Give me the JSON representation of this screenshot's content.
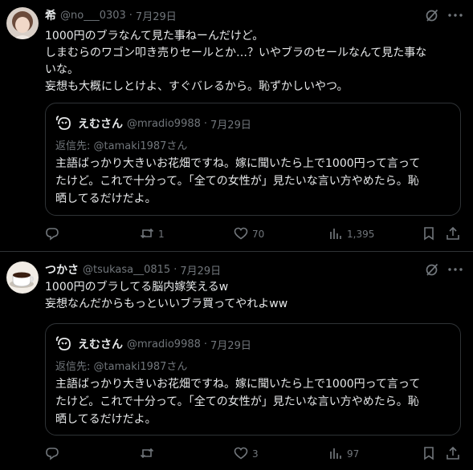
{
  "posts": [
    {
      "name": "希",
      "handle": "@no___0303",
      "dot": "·",
      "date": "7月29日",
      "lines": [
        "1000円のブラなんて見た事ねーんだけど。",
        "しまむらのワゴン叩き売りセールとか…？いやブラのセールなんて見た事な",
        "いな。",
        "妄想も大概にしとけよ、すぐバレるから。恥ずかしいやつ。"
      ],
      "quote": {
        "name": "えむさん",
        "handle": "@mradio9988",
        "dot": "·",
        "date": "7月29日",
        "reply_to": "返信先: @tamaki1987さん",
        "lines": [
          "主語ばっかり大きいお花畑ですね。嫁に聞いたら上で1000円って言って",
          "たけど。これで十分って。「全ての女性が」見たいな言い方やめたら。恥",
          "晒してるだけだよ。"
        ]
      },
      "actions": {
        "replies": "",
        "reposts": "1",
        "likes": "70",
        "views": "1,395"
      }
    },
    {
      "name": "つかさ",
      "handle": "@tsukasa__0815",
      "dot": "·",
      "date": "7月29日",
      "lines": [
        "1000円のブラしてる脳内嫁笑えるw",
        "妄想なんだからもっといいブラ買ってやれよww"
      ],
      "quote": {
        "name": "えむさん",
        "handle": "@mradio9988",
        "dot": "·",
        "date": "7月29日",
        "reply_to": "返信先: @tamaki1987さん",
        "lines": [
          "主語ばっかり大きいお花畑ですね。嫁に聞いたら上で1000円って言って",
          "たけど。これで十分って。「全ての女性が」見たいな言い方やめたら。恥",
          "晒してるだけだよ。"
        ]
      },
      "actions": {
        "replies": "",
        "reposts": "",
        "likes": "3",
        "views": "97"
      }
    }
  ],
  "icons": {
    "reply": "speech-bubble-icon",
    "repost": "repost-arrows-icon",
    "like": "heart-icon",
    "views": "bar-chart-icon",
    "bookmark": "bookmark-icon",
    "share": "share-upload-icon",
    "grok": "grok-slash-icon",
    "more": "more-dots-icon"
  },
  "colors": {
    "background": "#000000",
    "text": "#e7e9ea",
    "muted": "#71767b",
    "border": "#2f3336"
  }
}
